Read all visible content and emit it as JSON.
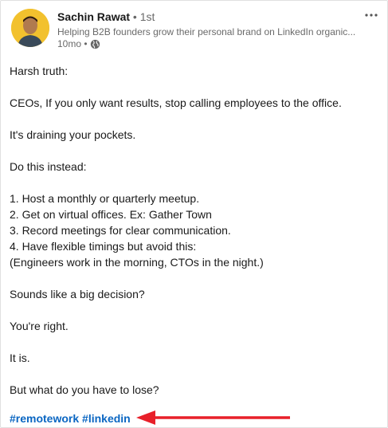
{
  "author": {
    "name": "Sachin Rawat",
    "degree": "• 1st",
    "headline": "Helping B2B founders grow their personal brand on LinkedIn organic...",
    "time": "10mo •",
    "visibility_icon": "globe-icon"
  },
  "menu": {
    "icon": "more-icon",
    "glyph": "···"
  },
  "post": {
    "lines": [
      "Harsh truth:",
      "",
      "CEOs, If you only want results, stop calling employees to the office.",
      "",
      "It's draining your pockets.",
      "",
      "Do this instead:",
      "",
      "1. Host a monthly or quarterly meetup.",
      "2. Get on virtual offices. Ex: Gather Town",
      "3. Record meetings for clear communication.",
      "4. Have flexible timings but avoid this:",
      "(Engineers work in the morning, CTOs in the night.)",
      "",
      "Sounds like a big decision?",
      "",
      "You're right.",
      "",
      "It is.",
      "",
      "But what do you have to lose?",
      ""
    ],
    "hashtags": [
      "#remotework",
      "#linkedin"
    ]
  },
  "colors": {
    "link": "#0a66c2",
    "arrow": "#e8202a",
    "avatar_bg": "#f2c12e"
  }
}
